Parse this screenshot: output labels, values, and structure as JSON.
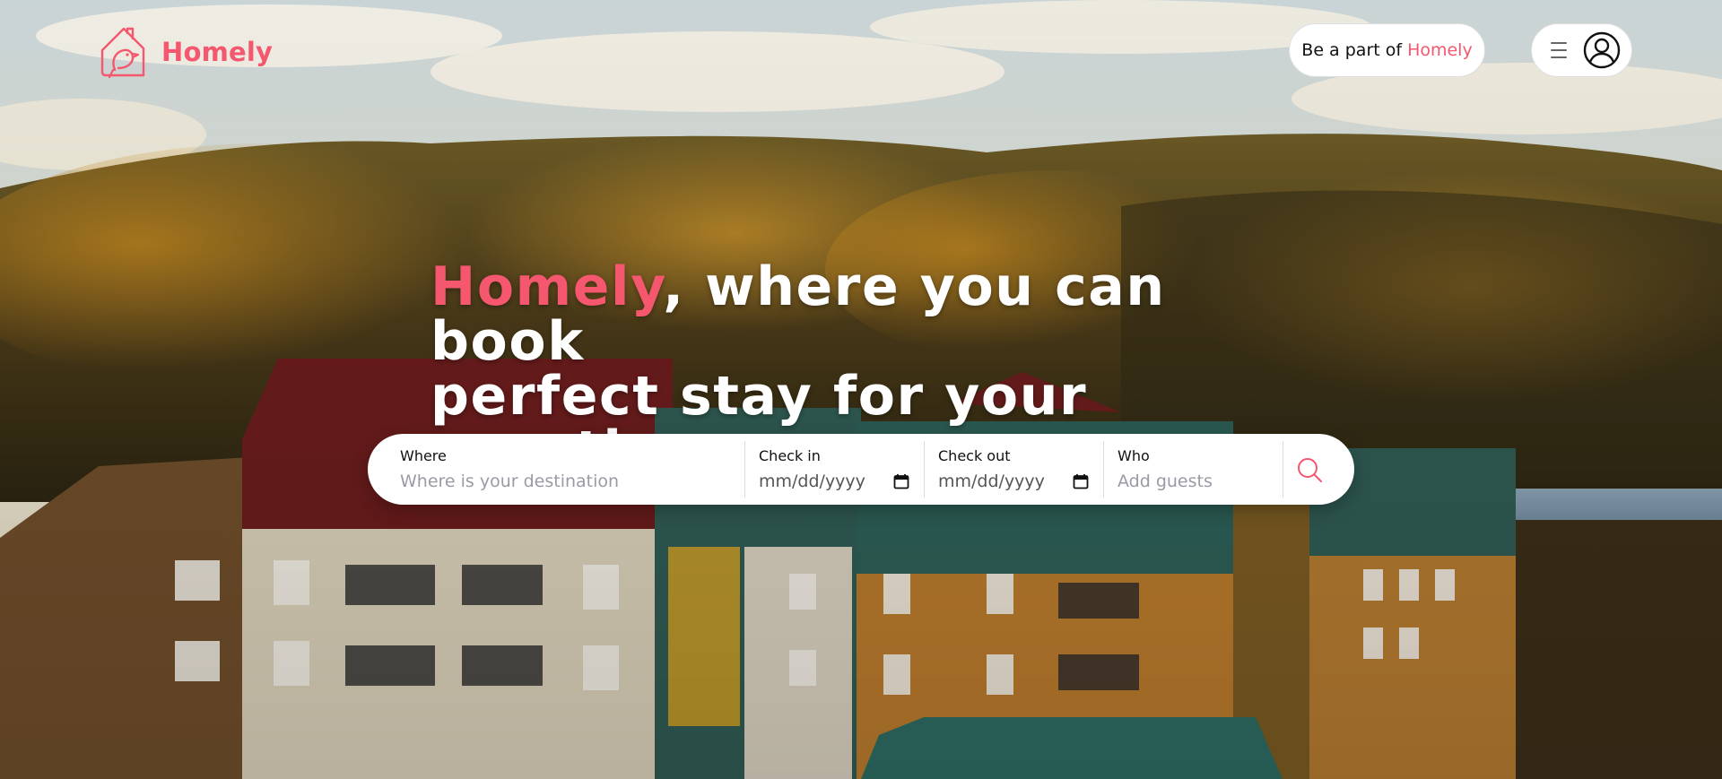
{
  "brand": {
    "name": "Homely",
    "accent_color": "#f4576e"
  },
  "header": {
    "cta_prefix": "Be a part of",
    "cta_brand": "Homely",
    "menu_icon": "hamburger-icon",
    "account_icon": "user-circle-icon"
  },
  "hero": {
    "headline_brand": "Homely",
    "headline_line1_rest": ", where you can book",
    "headline_line2": "perfect stay for your vacation"
  },
  "search": {
    "where": {
      "label": "Where",
      "placeholder": "Where is your destination"
    },
    "check_in": {
      "label": "Check in",
      "placeholder": "mm/dd/yyyy"
    },
    "check_out": {
      "label": "Check out",
      "placeholder": "mm/dd/yyyy"
    },
    "who": {
      "label": "Who",
      "placeholder": "Add guests"
    },
    "button_icon": "search-icon"
  }
}
